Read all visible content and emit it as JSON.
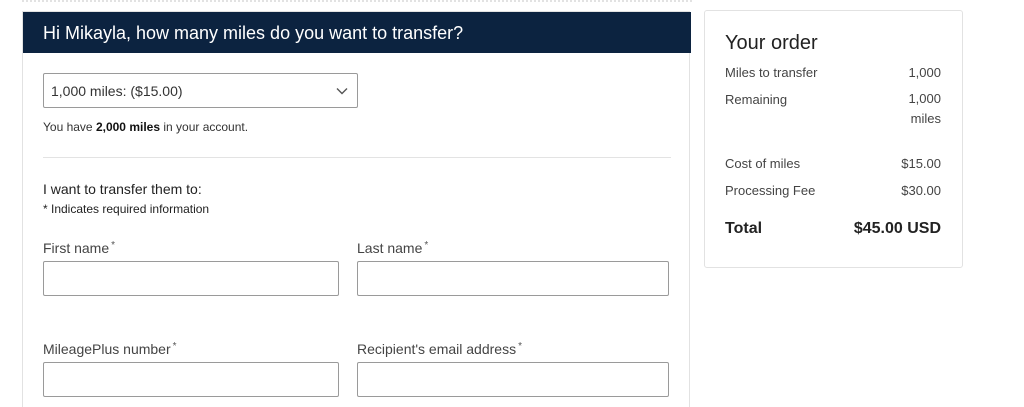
{
  "header": {
    "title": "Hi Mikayla, how many miles do you want to transfer?"
  },
  "miles_select": {
    "selected": "1,000 miles: ($15.00)"
  },
  "balance": {
    "prefix": "You have",
    "amount": "2,000 miles",
    "suffix": "in your account."
  },
  "recipient": {
    "heading": "I want to transfer them to:",
    "required_note": "* Indicates required information",
    "required_marker": "*",
    "first_name_label": "First name",
    "last_name_label": "Last name",
    "mileageplus_label": "MileagePlus number",
    "email_label": "Recipient's email address"
  },
  "order": {
    "title": "Your order",
    "miles_to_transfer_label": "Miles to transfer",
    "miles_to_transfer_value": "1,000",
    "remaining_label": "Remaining",
    "remaining_value_line1": "1,000",
    "remaining_value_line2": "miles",
    "cost_label": "Cost of miles",
    "cost_value": "$15.00",
    "fee_label": "Processing Fee",
    "fee_value": "$30.00",
    "total_label": "Total",
    "total_value": "$45.00 USD"
  },
  "colors": {
    "header_bg": "#0c2340",
    "header_text": "#ffffff",
    "border": "#9a9a9a"
  },
  "icons": {
    "select_chevron": "chevron-down-icon"
  }
}
